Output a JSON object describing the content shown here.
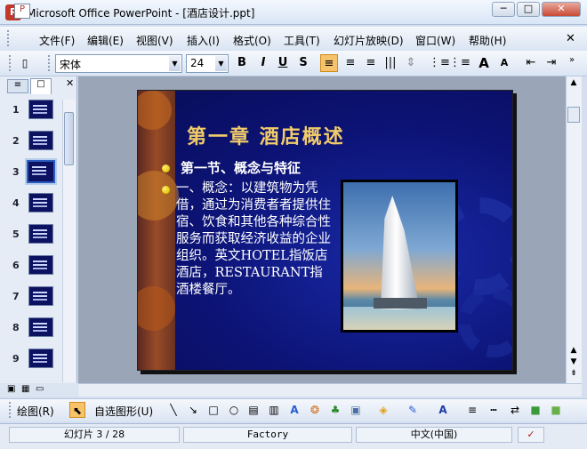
{
  "window": {
    "app_name": "Microsoft Office PowerPoint",
    "title": "Microsoft Office PowerPoint - [酒店设计.ppt]",
    "minimize": "─",
    "maximize": "□",
    "close": "✕"
  },
  "menu": {
    "icon": "P",
    "items": [
      "文件(F)",
      "编辑(E)",
      "视图(V)",
      "插入(I)",
      "格式(O)",
      "工具(T)",
      "幻灯片放映(D)",
      "窗口(W)",
      "帮助(H)"
    ],
    "doc_close": "✕"
  },
  "format_toolbar": {
    "new_icon": "new-document",
    "font": "宋体",
    "size": "24",
    "bold": "B",
    "italic": "I",
    "underline": "U",
    "shadow": "S",
    "align_left": "≡",
    "center": "≡",
    "align_right": "≡",
    "distribute": "|||",
    "numbering": "⋮≡",
    "bullets": "⋮≡",
    "grow": "A",
    "shrink": "A",
    "decrease_indent": "⇤",
    "increase_indent": "⇥",
    "accent_active": "#f7c36a"
  },
  "slide_pane": {
    "tab_outline": "≡",
    "tab_slides": "□",
    "close": "✕",
    "numbers": [
      "1",
      "2",
      "3",
      "4",
      "5",
      "6",
      "7",
      "8",
      "9"
    ],
    "selected": "3"
  },
  "slide": {
    "title": "第一章 酒店概述",
    "bullet1": "第一节、概念与特征",
    "body": "一、概念：以建筑物为凭借，通过为消费者者提供住宿、饮食和其他各种综合性服务而获取经济收益的企业组织。英文HOTEL指饭店酒店，RESTAURANT指酒楼餐厅。",
    "title_color": "#f2cc6a",
    "bg_color": "#0c1375"
  },
  "draw_toolbar": {
    "draw": "绘图(R)",
    "autoshapes": "自选图形(U)",
    "line": "╲",
    "arrow": "↘",
    "rect": "□",
    "oval": "○",
    "textbox": "▤",
    "vtextbox": "▥",
    "wordart": "A",
    "diagram": "❂",
    "clipart": "♣",
    "picture": "▣",
    "fill": "◈",
    "linecolor": "✎",
    "fontcolor": "A",
    "linestyle": "≡",
    "dashstyle": "┅",
    "arrowstyle": "⇄",
    "shadow": "■",
    "3d": "■"
  },
  "status": {
    "slide": "幻灯片 3 / 28",
    "design": "Factory",
    "language": "中文(中国)",
    "spell_icon": "✓"
  }
}
